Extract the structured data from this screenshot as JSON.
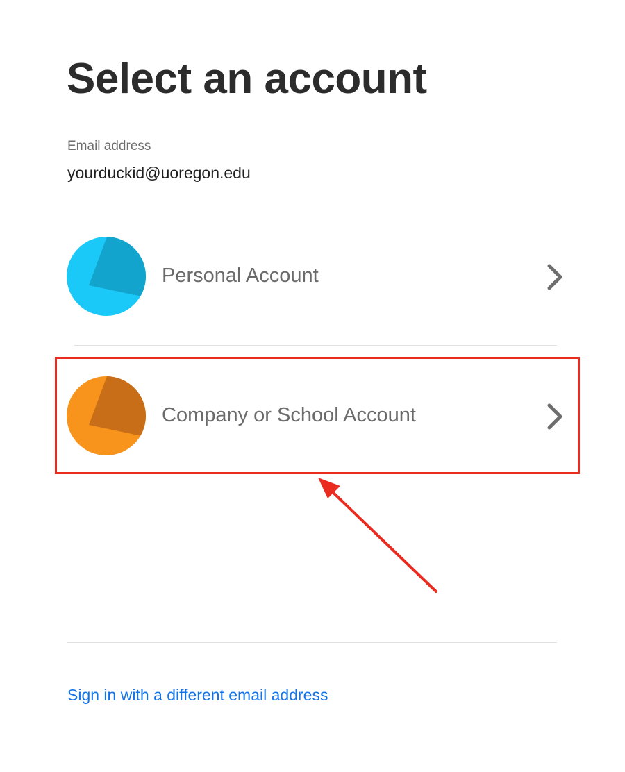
{
  "page": {
    "title": "Select an account"
  },
  "email": {
    "label": "Email address",
    "value": "yourduckid@uoregon.edu"
  },
  "accounts": [
    {
      "label": "Personal Account",
      "icon": "personal-account-icon",
      "color_base": "#1ac9f8",
      "color_shade": "#12a4cc"
    },
    {
      "label": "Company or School Account",
      "icon": "company-account-icon",
      "color_base": "#f8941c",
      "color_shade": "#c86e18"
    }
  ],
  "annotation": {
    "highlight_color": "#ea2b1f"
  },
  "footer": {
    "link_label": "Sign in with a different email address",
    "link_color": "#1473e6"
  }
}
